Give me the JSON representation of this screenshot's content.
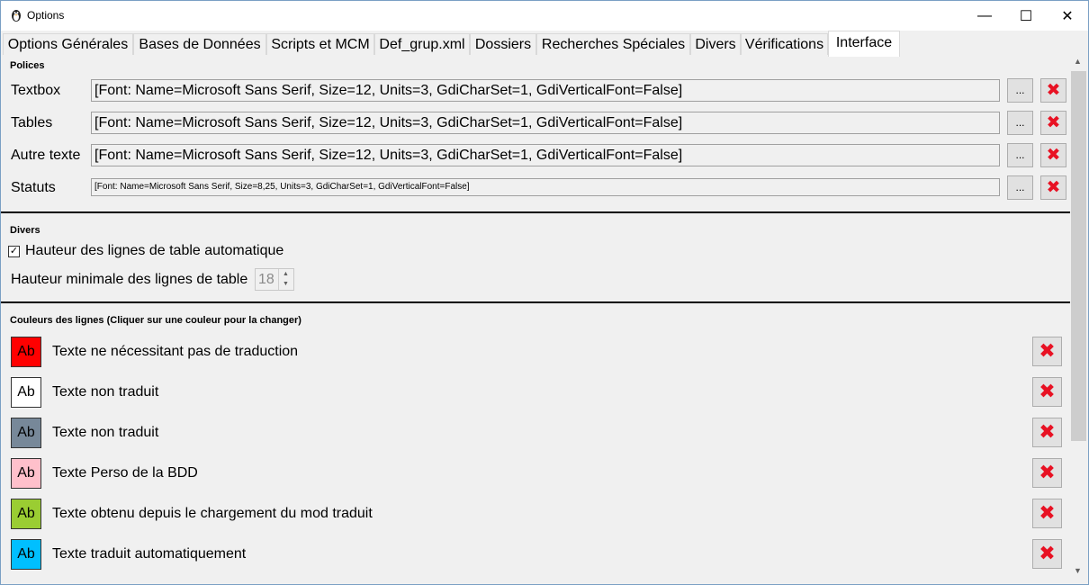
{
  "window": {
    "title": "Options"
  },
  "titlebar_buttons": {
    "minimize": "—",
    "maximize": "☐",
    "close": "✕"
  },
  "tabs": [
    {
      "label": "Options Générales"
    },
    {
      "label": "Bases de Données"
    },
    {
      "label": "Scripts et MCM"
    },
    {
      "label": "Def_grup.xml"
    },
    {
      "label": "Dossiers"
    },
    {
      "label": "Recherches Spéciales"
    },
    {
      "label": "Divers"
    },
    {
      "label": "Vérifications"
    },
    {
      "label": "Interface"
    }
  ],
  "active_tab": "Interface",
  "polices": {
    "title": "Polices",
    "dots_label": "...",
    "rows": [
      {
        "label": "Textbox",
        "value": "[Font: Name=Microsoft Sans Serif, Size=12, Units=3, GdiCharSet=1, GdiVerticalFont=False]"
      },
      {
        "label": "Tables",
        "value": "[Font: Name=Microsoft Sans Serif, Size=12, Units=3, GdiCharSet=1, GdiVerticalFont=False]"
      },
      {
        "label": "Autre texte",
        "value": "[Font: Name=Microsoft Sans Serif, Size=12, Units=3, GdiCharSet=1, GdiVerticalFont=False]"
      },
      {
        "label": "Statuts",
        "value": "[Font: Name=Microsoft Sans Serif, Size=8,25, Units=3, GdiCharSet=1, GdiVerticalFont=False]"
      }
    ]
  },
  "divers": {
    "title": "Divers",
    "auto_height_label": "Hauteur des lignes de table automatique",
    "auto_height_checked": true,
    "min_height_label": "Hauteur minimale des lignes de table",
    "min_height_value": "18"
  },
  "couleurs": {
    "title": "Couleurs des lignes (Cliquer sur une couleur pour la changer)",
    "swatch_text": "Ab",
    "rows": [
      {
        "label": "Texte ne nécessitant pas de traduction",
        "color": "#ff0000"
      },
      {
        "label": "Texte non traduit",
        "color": "#ffffff"
      },
      {
        "label": "Texte non traduit",
        "color": "#778899"
      },
      {
        "label": "Texte Perso de la BDD",
        "color": "#ffc0cb"
      },
      {
        "label": "Texte obtenu depuis le chargement du mod traduit",
        "color": "#9acd32"
      },
      {
        "label": "Texte traduit automatiquement",
        "color": "#00bfff"
      }
    ]
  },
  "colors": {
    "delete_x": "#e81123",
    "window_border": "#7a9fc4",
    "background": "#f0f0f0"
  }
}
